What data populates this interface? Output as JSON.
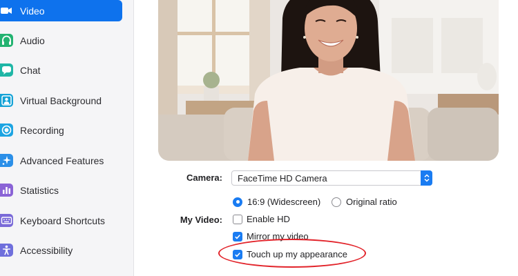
{
  "sidebar": {
    "items": [
      {
        "label": "Video",
        "icon": "video-camera-icon",
        "color": "#0e72ed",
        "active": true
      },
      {
        "label": "Audio",
        "icon": "headphones-icon",
        "color": "#23b371",
        "active": false
      },
      {
        "label": "Chat",
        "icon": "chat-bubble-icon",
        "color": "#1fb6a6",
        "active": false
      },
      {
        "label": "Virtual Background",
        "icon": "person-background-icon",
        "color": "#14a2d6",
        "active": false
      },
      {
        "label": "Recording",
        "icon": "record-icon",
        "color": "#1ca4e2",
        "active": false
      },
      {
        "label": "Advanced Features",
        "icon": "sparkle-icon",
        "color": "#2b8fe8",
        "active": false
      },
      {
        "label": "Statistics",
        "icon": "bar-chart-icon",
        "color": "#8a63d6",
        "active": false
      },
      {
        "label": "Keyboard Shortcuts",
        "icon": "keyboard-icon",
        "color": "#7a6ad8",
        "active": false
      },
      {
        "label": "Accessibility",
        "icon": "accessibility-icon",
        "color": "#6f6fdc",
        "active": false
      }
    ]
  },
  "camera": {
    "label": "Camera:",
    "selected": "FaceTime HD Camera"
  },
  "my_video": {
    "label": "My Video:",
    "ratio_widescreen": "16:9 (Widescreen)",
    "ratio_original": "Original ratio",
    "enable_hd": "Enable HD",
    "mirror": "Mirror my video",
    "touch_up": "Touch up my appearance"
  },
  "colors": {
    "accent": "#1a7cf2",
    "highlight_ring": "#e2232a"
  }
}
